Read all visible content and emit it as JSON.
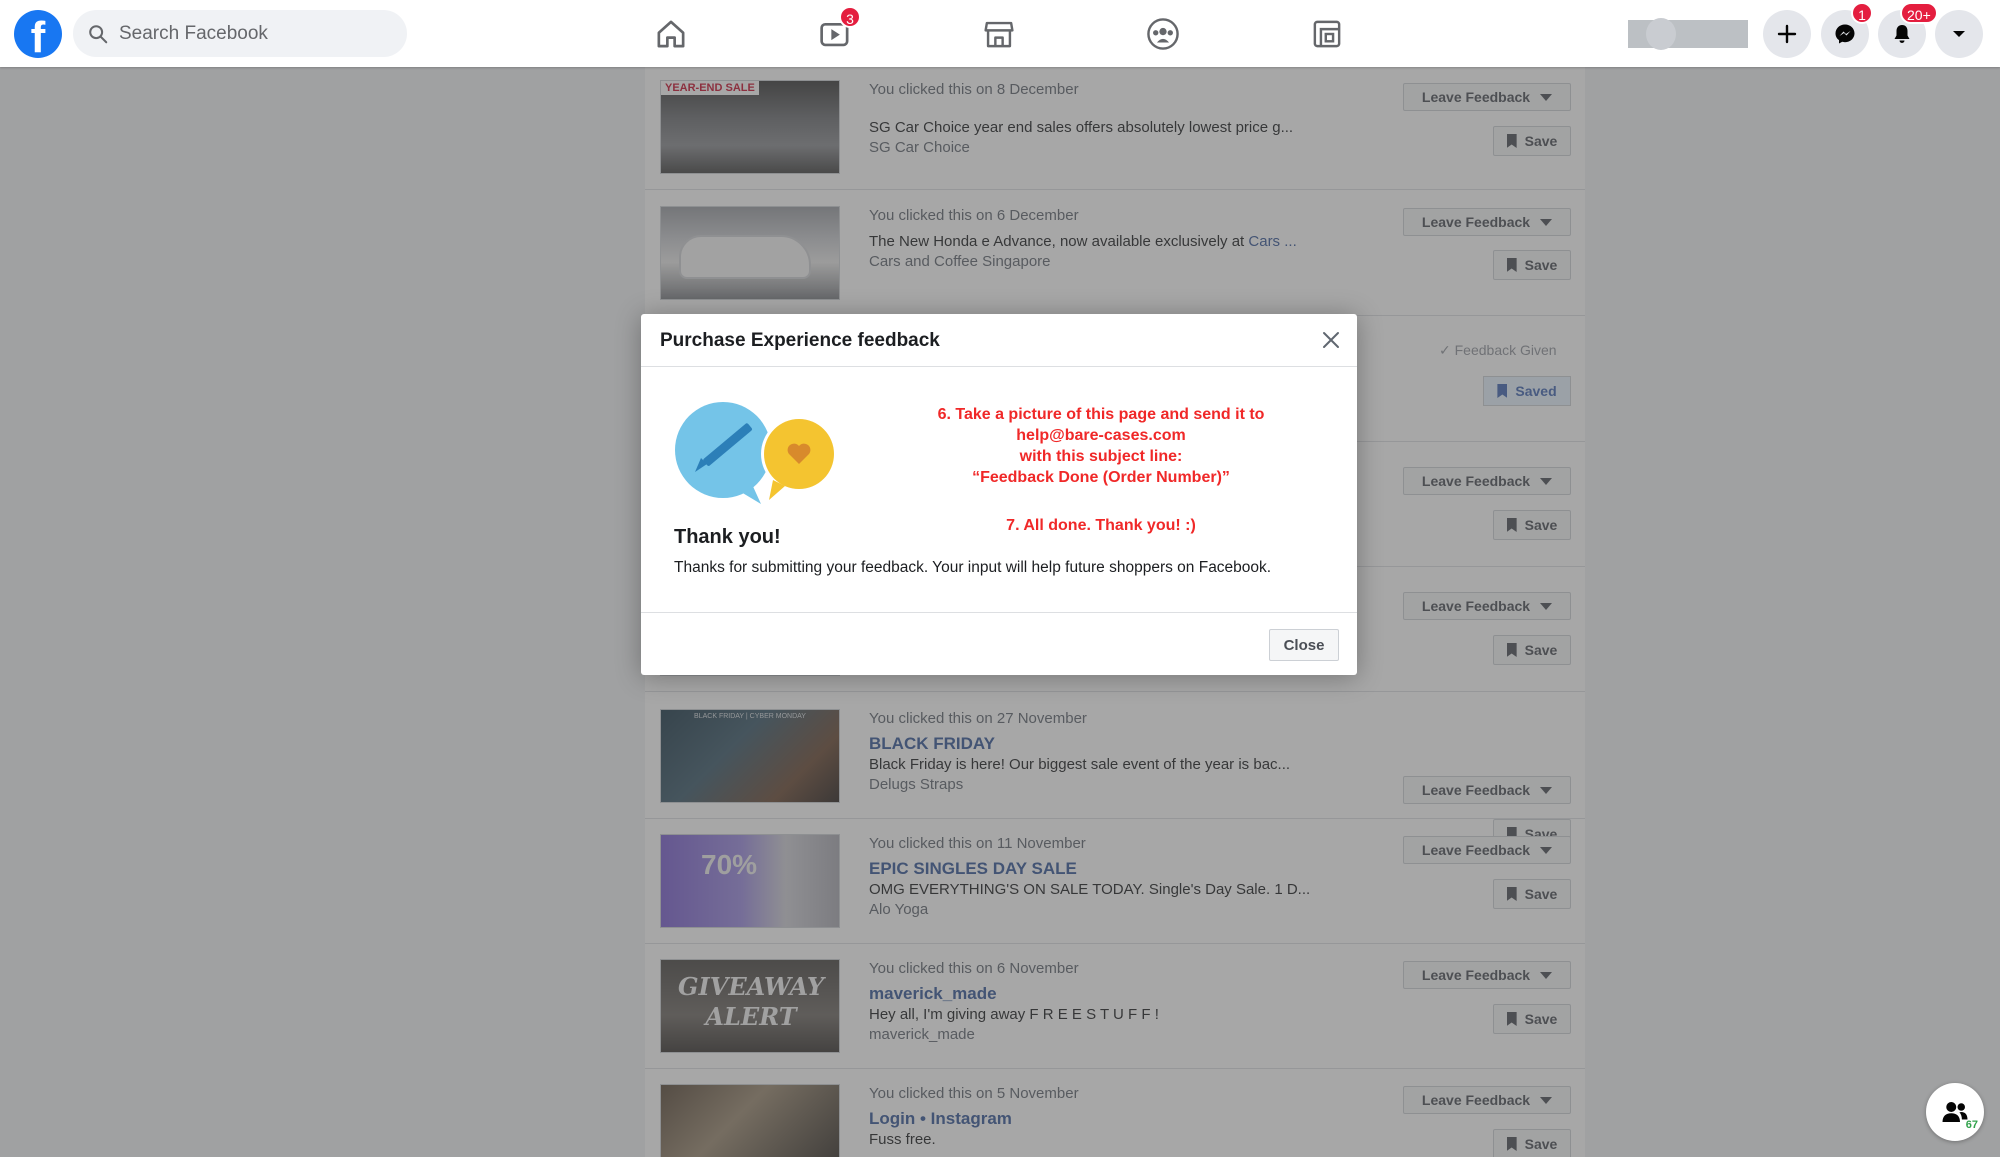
{
  "nav": {
    "search_placeholder": "Search Facebook",
    "watch_badge": "3",
    "messenger_badge": "1",
    "notifications_badge": "20+"
  },
  "rows": [
    {
      "meta": "You clicked this on 8 December",
      "title": "",
      "desc": "SG Car Choice year end sales offers absolutely lowest price g...",
      "source": "SG Car Choice",
      "thumb_label": "YEAR-END SALE"
    },
    {
      "meta": "You clicked this on 6 December",
      "title": "",
      "desc": "The New Honda e Advance, now available exclusively at",
      "desc_link": "Cars ...",
      "source": "Cars and Coffee Singapore"
    },
    {
      "status": "Feedback Given",
      "save": "Saved"
    },
    {},
    {},
    {
      "meta": "You clicked this on 27 November",
      "title": "BLACK FRIDAY",
      "desc": "Black Friday is here! Our biggest sale event of the year is bac...",
      "source": "Delugs Straps",
      "thumb_label": "BLACK FRIDAY | CYBER MONDAY"
    },
    {
      "meta": "You clicked this on 11 November",
      "title": "EPIC SINGLES DAY SALE",
      "desc": "OMG EVERYTHING'S ON SALE TODAY. Single's Day Sale. 1 D...",
      "source": "Alo Yoga",
      "thumb_label": "70%"
    },
    {
      "meta": "You clicked this on 6 November",
      "title": "maverick_made",
      "desc": "Hey all, I'm giving away F R E E S T U F F !",
      "source": "maverick_made",
      "thumb_label": "GIVEAWAY ALERT"
    },
    {
      "meta": "You clicked this on 5 November",
      "title": "Login • Instagram",
      "desc": "Fuss free.",
      "source": ""
    }
  ],
  "buttons": {
    "leave_feedback": "Leave Feedback",
    "save": "Save"
  },
  "modal": {
    "title": "Purchase Experience feedback",
    "instructions": [
      "6. Take a picture of this page and send it to",
      "help@bare-cases.com",
      "with this subject line:",
      "“Feedback Done (Order Number)”",
      "",
      "7. All done. Thank you! :)"
    ],
    "heading": "Thank you!",
    "message": "Thanks for submitting your feedback. Your input will help future shoppers on Facebook.",
    "close_label": "Close"
  },
  "contacts_count": "67",
  "colors": {
    "brand_blue": "#1877f2",
    "link_blue": "#365899",
    "instruction_red": "#f02828",
    "badge_red": "#e41e3f"
  }
}
